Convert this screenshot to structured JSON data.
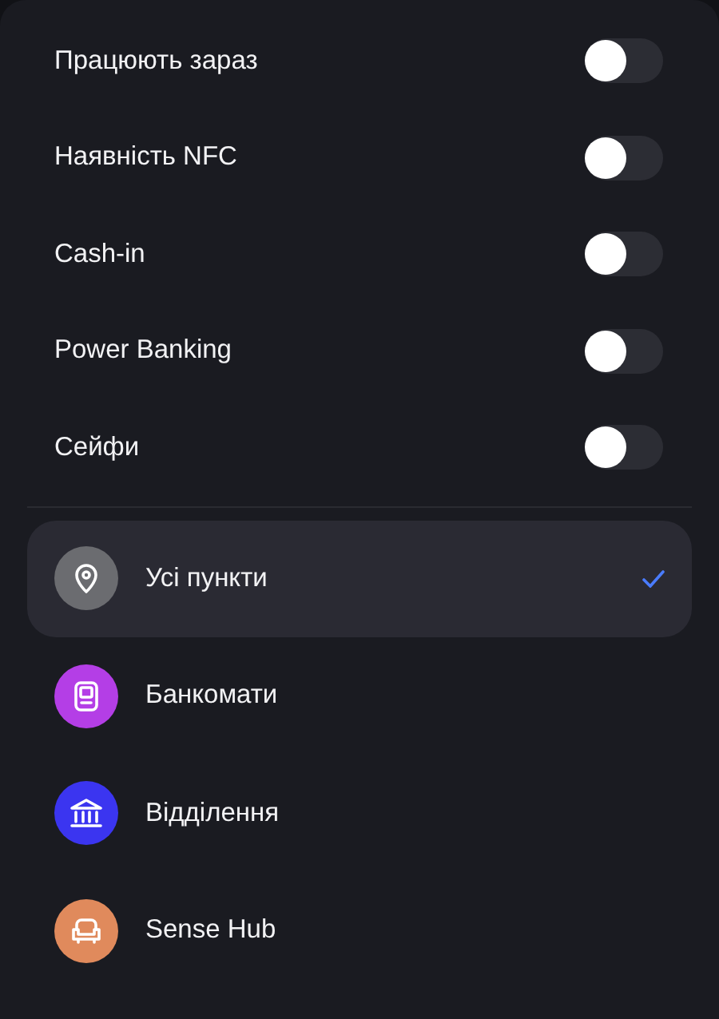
{
  "filters": [
    {
      "label": "Працюють зараз",
      "on": false
    },
    {
      "label": "Наявність NFC",
      "on": false
    },
    {
      "label": "Cash-in",
      "on": false
    },
    {
      "label": "Power Banking",
      "on": false
    },
    {
      "label": "Сейфи",
      "on": false
    }
  ],
  "categories": [
    {
      "label": "Усі пункти",
      "kind": "pin",
      "color": "#6b6c70",
      "selected": true
    },
    {
      "label": "Банкомати",
      "kind": "atm",
      "color": "#b43ee6",
      "selected": false
    },
    {
      "label": "Відділення",
      "kind": "bank",
      "color": "#3b35f0",
      "selected": false
    },
    {
      "label": "Sense Hub",
      "kind": "sofa",
      "color": "#e08a5c",
      "selected": false
    }
  ]
}
